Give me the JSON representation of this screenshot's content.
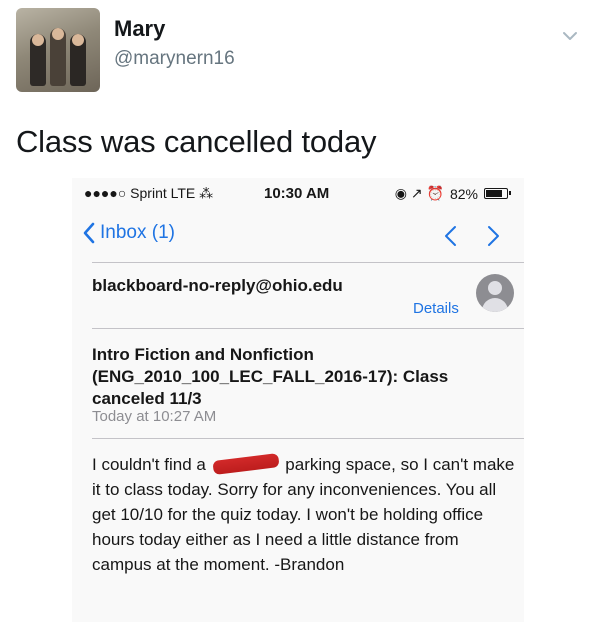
{
  "tweet": {
    "display_name": "Mary",
    "handle": "@marynern16",
    "text": "Class was cancelled today"
  },
  "status_bar": {
    "carrier": "●●●●○ Sprint  LTE  ⁂",
    "time": "10:30 AM",
    "indicators": "◉ ↗ ⏰",
    "battery_percent": "82%",
    "battery_level": 0.82
  },
  "nav": {
    "back_label": "Inbox (1)"
  },
  "email": {
    "sender": "blackboard-no-reply@ohio.edu",
    "details_label": "Details",
    "subject": "Intro Fiction and Nonfiction (ENG_2010_100_LEC_FALL_2016-17): Class canceled 11/3",
    "date": "Today at 10:27 AM",
    "body_before": "I couldn't find a",
    "body_after": "parking space, so I can't make it to class today. Sorry for any inconveniences. You all get 10/10 for the quiz today. I won't be holding office hours today either as I need a little distance from campus at the moment. -Brandon"
  },
  "colors": {
    "link_blue": "#1a73e8",
    "redaction": "#d62424",
    "handle_gray": "#66757f"
  }
}
